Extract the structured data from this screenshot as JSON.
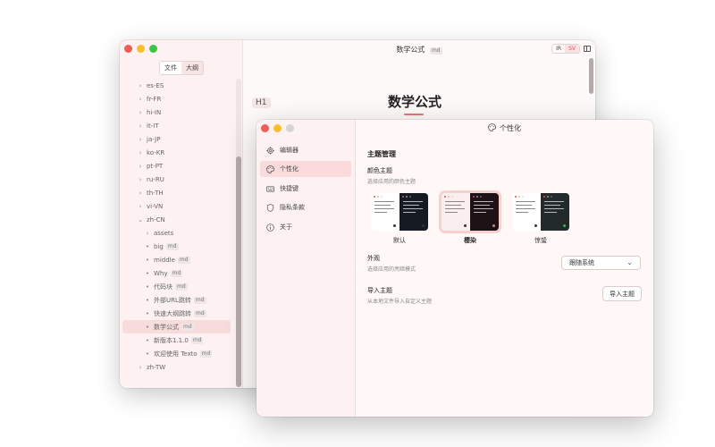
{
  "back_window": {
    "sidebar": {
      "segment": [
        "文件",
        "大纲"
      ],
      "tree": [
        {
          "label": "es-ES",
          "arrow": "›",
          "indent": 0,
          "badge": ""
        },
        {
          "label": "fr-FR",
          "arrow": "›",
          "indent": 0,
          "badge": ""
        },
        {
          "label": "hi-IN",
          "arrow": "›",
          "indent": 0,
          "badge": ""
        },
        {
          "label": "it-IT",
          "arrow": "›",
          "indent": 0,
          "badge": ""
        },
        {
          "label": "ja-JP",
          "arrow": "›",
          "indent": 0,
          "badge": ""
        },
        {
          "label": "ko-KR",
          "arrow": "›",
          "indent": 0,
          "badge": ""
        },
        {
          "label": "pt-PT",
          "arrow": "›",
          "indent": 0,
          "badge": ""
        },
        {
          "label": "ru-RU",
          "arrow": "›",
          "indent": 0,
          "badge": ""
        },
        {
          "label": "th-TH",
          "arrow": "›",
          "indent": 0,
          "badge": ""
        },
        {
          "label": "vi-VN",
          "arrow": "›",
          "indent": 0,
          "badge": ""
        },
        {
          "label": "zh-CN",
          "arrow": "⌄",
          "indent": 0,
          "badge": ""
        },
        {
          "label": "assets",
          "arrow": "›",
          "indent": 1,
          "badge": ""
        },
        {
          "label": "big",
          "arrow": "•",
          "indent": 1,
          "badge": "md"
        },
        {
          "label": "middle",
          "arrow": "•",
          "indent": 1,
          "badge": "md"
        },
        {
          "label": "Why",
          "arrow": "•",
          "indent": 1,
          "badge": "md"
        },
        {
          "label": "代码块",
          "arrow": "•",
          "indent": 1,
          "badge": "md"
        },
        {
          "label": "外部URL跳转",
          "arrow": "•",
          "indent": 1,
          "badge": "md"
        },
        {
          "label": "快速大纲跳转",
          "arrow": "•",
          "indent": 1,
          "badge": "md"
        },
        {
          "label": "数学公式",
          "arrow": "•",
          "indent": 1,
          "badge": "md",
          "selected": true
        },
        {
          "label": "新版本1.1.0",
          "arrow": "•",
          "indent": 1,
          "badge": "md"
        },
        {
          "label": "欢迎使用 Texto",
          "arrow": "•",
          "indent": 1,
          "badge": "md"
        },
        {
          "label": "zh-TW",
          "arrow": "›",
          "indent": 0,
          "badge": ""
        }
      ]
    },
    "title": "数学公式",
    "title_badge": "md",
    "mode_toggle": [
      "IR",
      "SV"
    ],
    "h1_tag": "H1",
    "heading": "数学公式"
  },
  "settings": {
    "window_title": "个性化",
    "nav": [
      {
        "label": "编辑器",
        "icon": "gear-icon"
      },
      {
        "label": "个性化",
        "icon": "palette-icon",
        "active": true
      },
      {
        "label": "快捷键",
        "icon": "keyboard-icon"
      },
      {
        "label": "隐私条款",
        "icon": "shield-icon"
      },
      {
        "label": "关于",
        "icon": "info-icon"
      }
    ],
    "section_title": "主题管理",
    "color_theme": {
      "label": "颜色主题",
      "desc": "选择应用的颜色主题",
      "themes": [
        {
          "name": "默认",
          "light": "#ffffff",
          "dark": "#161a22",
          "accent": "#e05050",
          "fab": "#333333"
        },
        {
          "name": "樱染",
          "light": "#fbeeee",
          "dark": "#1e1216",
          "accent": "#e05050",
          "fab": "#e07a7a",
          "selected": true
        },
        {
          "name": "惊蛰",
          "light": "#ffffff",
          "dark": "#222a2c",
          "accent": "#e05050",
          "fab": "#3cb44b"
        }
      ]
    },
    "appearance": {
      "label": "外观",
      "desc": "选择应用的亮暗模式",
      "value": "跟随系统"
    },
    "import_theme": {
      "label": "导入主题",
      "desc": "从本地文件导入自定义主题",
      "button": "导入主题"
    }
  }
}
